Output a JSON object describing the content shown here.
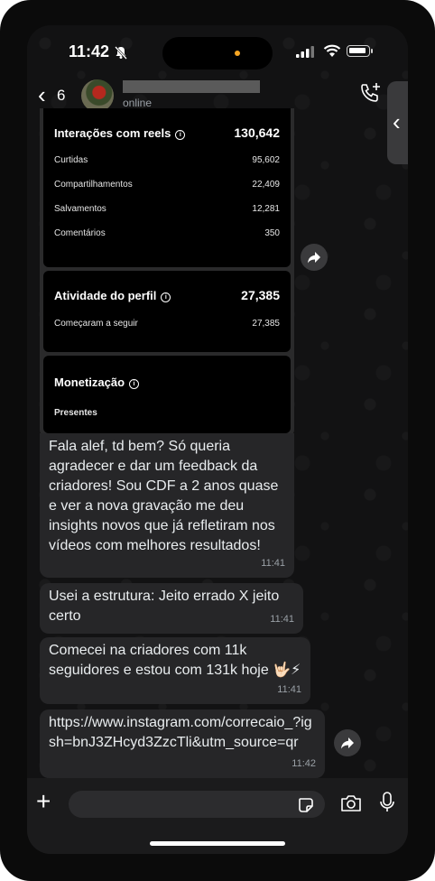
{
  "status_bar": {
    "time": "11:42"
  },
  "header": {
    "back_count": "6",
    "contact_status": "online"
  },
  "insights": {
    "reels": {
      "title": "Interações com reels",
      "total": "130,642",
      "rows": [
        {
          "label": "Curtidas",
          "value": "95,602"
        },
        {
          "label": "Compartilhamentos",
          "value": "22,409"
        },
        {
          "label": "Salvamentos",
          "value": "12,281"
        },
        {
          "label": "Comentários",
          "value": "350"
        }
      ]
    },
    "profile": {
      "title": "Atividade do perfil",
      "total": "27,385",
      "rows": [
        {
          "label": "Começaram a seguir",
          "value": "27,385"
        }
      ]
    },
    "monetization": {
      "title": "Monetização",
      "subtitle": "Presentes"
    }
  },
  "messages": [
    {
      "text": "Fala alef, td bem? Só queria agradecer e dar um feedback da criadores! Sou CDF a 2 anos quase e ver a nova gravação me deu insights novos que já refletiram nos vídeos com melhores resultados!",
      "time": "11:41"
    },
    {
      "text": "Usei a estrutura: Jeito errado X jeito certo",
      "time": "11:41"
    },
    {
      "text": "Comecei na criadores com 11k seguidores e estou com 131k hoje 🤟🏻⚡",
      "time": "11:41"
    },
    {
      "text": "https://www.instagram.com/correcaio_?igsh=bnJ3ZHcyd3ZzcTli&utm_source=qr",
      "time": "11:42"
    }
  ],
  "colors": {
    "bubble": "#262628",
    "background": "#121213",
    "card": "#000000"
  }
}
